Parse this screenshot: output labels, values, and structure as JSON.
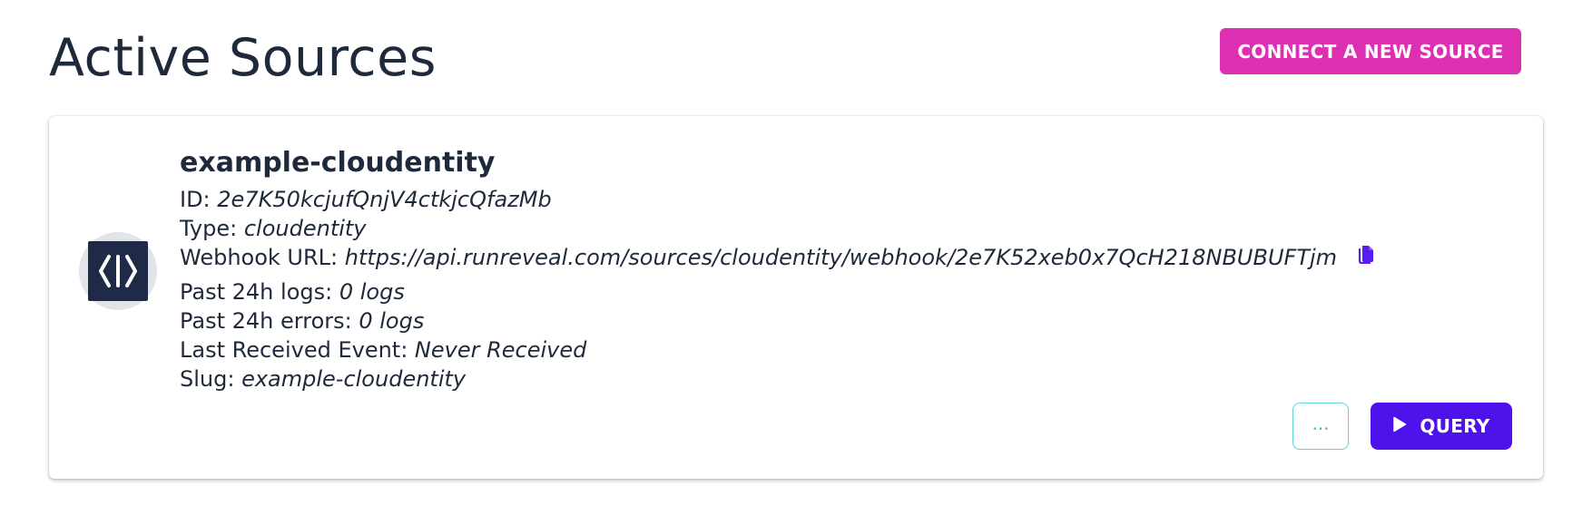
{
  "header": {
    "title": "Active Sources",
    "connect_button": "CONNECT A NEW SOURCE"
  },
  "source": {
    "logo_icon": "code-brackets-icon",
    "name": "example-cloudentity",
    "fields": [
      {
        "label": "ID: ",
        "value": "2e7K50kcjufQnjV4ctkjcQfazMb"
      },
      {
        "label": "Type: ",
        "value": "cloudentity"
      },
      {
        "label": "Webhook URL: ",
        "value": "https://api.runreveal.com/sources/cloudentity/webhook/2e7K52xeb0x7QcH218NBUBUFTjm"
      },
      {
        "label": "Past 24h logs: ",
        "value": "0 logs"
      },
      {
        "label": "Past 24h errors: ",
        "value": "0 logs"
      },
      {
        "label": "Last Received Event: ",
        "value": "Never Received"
      },
      {
        "label": "Slug: ",
        "value": "example-cloudentity"
      }
    ],
    "copy_icon": "copy-icon",
    "more_button": "...",
    "query_button": "QUERY"
  },
  "colors": {
    "connect_button_bg": "#dc2fb2",
    "query_button_bg": "#4f12eb",
    "copy_icon": "#5b1cf0",
    "more_button_border": "#5fd3cf",
    "text": "#1e293b"
  }
}
